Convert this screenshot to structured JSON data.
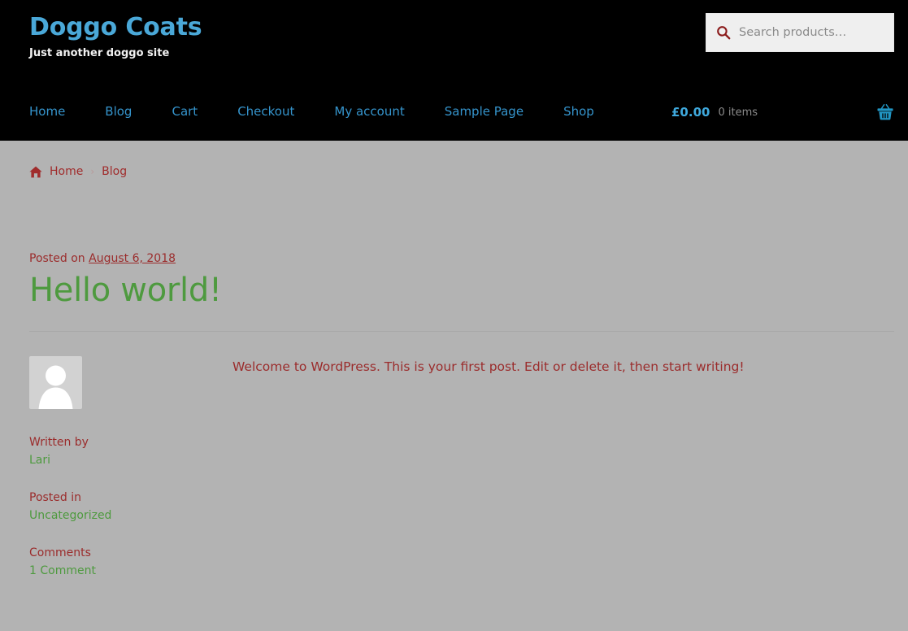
{
  "header": {
    "site_title": "Doggo Coats",
    "site_description": "Just another doggo site",
    "search": {
      "placeholder": "Search products…",
      "value": "",
      "icon": "search-icon"
    },
    "nav": [
      {
        "label": "Home"
      },
      {
        "label": "Blog"
      },
      {
        "label": "Cart"
      },
      {
        "label": "Checkout"
      },
      {
        "label": "My account"
      },
      {
        "label": "Sample Page"
      },
      {
        "label": "Shop"
      }
    ],
    "cart": {
      "amount": "£0.00",
      "count": "0 items",
      "icon": "shopping-basket-icon"
    }
  },
  "breadcrumb": {
    "home_icon": "home-icon",
    "home_label": "Home",
    "separator": "›",
    "current_label": "Blog"
  },
  "post": {
    "posted_on_prefix": "Posted on",
    "date": "August 6, 2018",
    "title": "Hello world!",
    "content": "Welcome to WordPress. This is your first post. Edit or delete it, then start writing!",
    "avatar_icon": "avatar-placeholder-icon",
    "meta": [
      {
        "label": "Written by",
        "value": "Lari"
      },
      {
        "label": "Posted in",
        "value": "Uncategorized"
      },
      {
        "label": "Comments",
        "value": "1 Comment"
      }
    ]
  },
  "colors": {
    "header_bg": "#000000",
    "page_bg": "#b3b3b3",
    "site_title": "#4aa8d8",
    "nav_link": "#3594cc",
    "cart_amount": "#3fa9dd",
    "accent_red": "#9b2c2c",
    "accent_green": "#4e9a3f",
    "search_bg": "#efefef"
  }
}
